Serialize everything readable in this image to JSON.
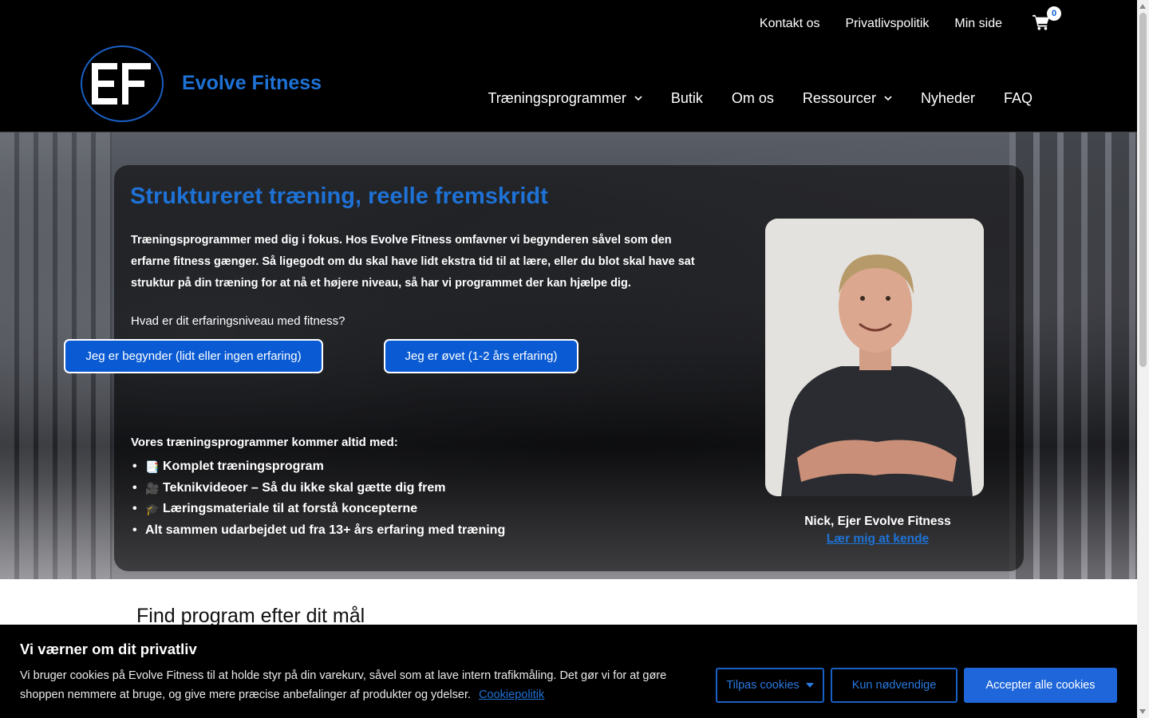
{
  "header": {
    "brand_name": "Evolve Fitness",
    "logo_text": "EF",
    "top_nav": [
      "Kontakt os",
      "Privatlivspolitik",
      "Min side"
    ],
    "cart_count": "0",
    "main_nav": [
      {
        "label": "Træningsprogrammer",
        "has_dropdown": true
      },
      {
        "label": "Butik",
        "has_dropdown": false
      },
      {
        "label": "Om os",
        "has_dropdown": false
      },
      {
        "label": "Ressourcer",
        "has_dropdown": true
      },
      {
        "label": "Nyheder",
        "has_dropdown": false
      },
      {
        "label": "FAQ",
        "has_dropdown": false
      }
    ]
  },
  "hero": {
    "title": "Struktureret træning, reelle fremskridt",
    "intro": "Træningsprogrammer med dig i fokus. Hos Evolve Fitness omfavner vi begynderen såvel som den erfarne fitness gænger. Så ligegodt om du skal have lidt ekstra tid til at lære, eller du blot skal have sat struktur på din træning for at nå et højere niveau, så har vi programmet der kan hjælpe dig.",
    "question": "Hvad er dit erfaringsniveau med fitness?",
    "btn_beginner": "Jeg er begynder (lidt eller ingen erfaring)",
    "btn_advanced": "Jeg er øvet (1-2 års erfaring)",
    "features_heading": "Vores træningsprogrammer kommer altid med:",
    "features": [
      {
        "icon": "📑",
        "text": "Komplet træningsprogram"
      },
      {
        "icon": "🎥",
        "text": "Teknikvideoer – Så du ikke skal gætte dig frem"
      },
      {
        "icon": "🎓",
        "text": "Læringsmateriale til at forstå koncepterne"
      },
      {
        "icon": "",
        "text": "Alt sammen udarbejdet ud fra 13+ års erfaring med træning"
      }
    ],
    "caption": "Nick, Ejer Evolve Fitness",
    "caption_link": "Lær mig at kende"
  },
  "section": {
    "title": "Find program efter dit mål"
  },
  "cookie": {
    "title": "Vi værner om dit privatliv",
    "text": "Vi bruger cookies på Evolve Fitness til at holde styr på din varekurv, såvel som at lave intern trafikmåling. Det gør vi for at gøre shoppen nemmere at bruge, og give mere præcise anbefalinger af produkter og ydelser.",
    "policy_link": "Cookiepolitik",
    "btn_customize": "Tilpas cookies",
    "btn_necessary": "Kun nødvendige",
    "btn_accept": "Accepter alle cookies"
  },
  "colors": {
    "accent": "#1e72d6",
    "button_blue": "#0a5bd3",
    "header_bg": "#000000"
  }
}
